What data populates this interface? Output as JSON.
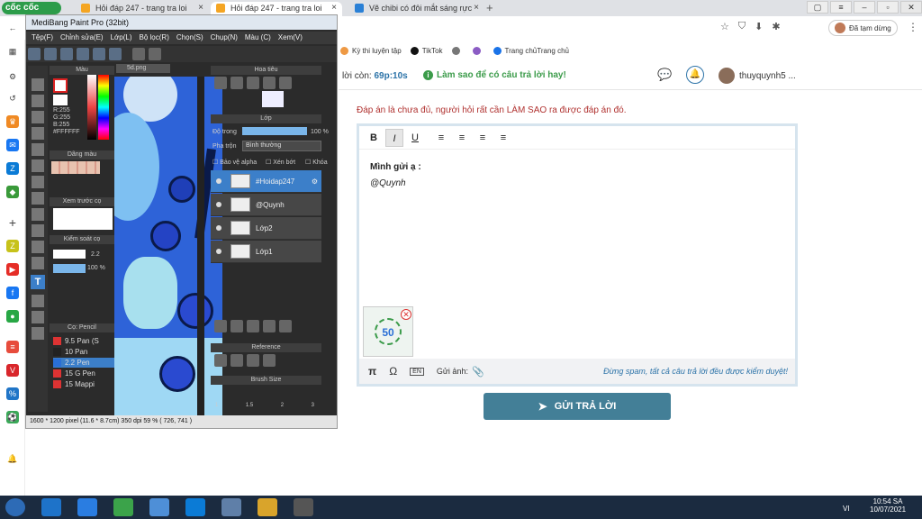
{
  "browser": {
    "logo": "cốc cốc",
    "tabs": [
      {
        "title": "Hỏi đáp 247 - trang tra loi",
        "active": false
      },
      {
        "title": "Hỏi đáp 247 - trang tra loi",
        "active": true
      },
      {
        "title": "Vẽ chibi có đôi mắt sáng rực",
        "active": false
      }
    ],
    "new_tab": "+",
    "bookmarks": [
      "Kỳ thi luyện tập",
      "TikTok",
      "",
      "",
      "Trang chủ",
      "Trang chủ"
    ],
    "paused_label": "Đã tạm dừng"
  },
  "site": {
    "time_left_label": "lời còn:",
    "time_left_value": "69p:10s",
    "tip": "Làm sao để có câu trả lời hay!",
    "username": "thuyquynh5 ...",
    "instruction": "Đáp án là chưa đủ, người hỏi rất cần LÀM SAO ra được đáp án đó.",
    "editor": {
      "tools": [
        "B",
        "I",
        "U",
        "≡",
        "≡",
        "≡",
        "≡"
      ],
      "line1": "Mình gửi ạ :",
      "line2": "@Quynh",
      "thumb_text": "50"
    },
    "footer": {
      "pi": "π",
      "omega": "Ω",
      "attach_label": "Gửi ảnh:",
      "notice": "Đừng spam, tất cả câu trả lời đều được kiểm duyệt!"
    },
    "submit_label": "GỬI TRẢ LỜI"
  },
  "medibang": {
    "title": "MediBang Paint Pro (32bit)",
    "menu": [
      "Tệp(F)",
      "Chỉnh sửa(E)",
      "Lớp(L)",
      "Bộ lọc(R)",
      "Chọn(S)",
      "Chụp(N)",
      "Màu (C)",
      "Xem(V)"
    ],
    "panels": {
      "color": "Màu",
      "color_values": [
        "R:255",
        "G:255",
        "B:255",
        "#FFFFFF"
      ],
      "color_bar": "Dãng màu",
      "preview": "Xem trước cọ",
      "brush_control": "Kiểm soát cọ",
      "brush_size": "2.2",
      "brush_opacity": "100 %",
      "brush_list": "Cọ: Pencil",
      "navigator": "Hoa tiêu",
      "layer": "Lớp",
      "opacity_label": "Độ trong",
      "opacity_value": "100 %",
      "blend_label": "Pha trộn",
      "blend_value": "Bình thường",
      "protect_alpha": "Bảo vệ alpha",
      "clipping": "Xén bớt",
      "lock": "Khóa",
      "reference": "Reference",
      "brush_size_panel": "Brush Size",
      "canvas_tab": "5d.png"
    },
    "layers": [
      {
        "name": "#Hoidap247",
        "selected": true
      },
      {
        "name": "@Quynh",
        "selected": false
      },
      {
        "name": "Lớp2",
        "selected": false
      },
      {
        "name": "Lớp1",
        "selected": false
      }
    ],
    "pens": [
      {
        "size": "9.5",
        "name": "Pan (S",
        "color": "#d33"
      },
      {
        "size": "10",
        "name": "Pan",
        "color": "#222"
      },
      {
        "size": "2.2",
        "name": "Pen",
        "color": "#2a6fd6"
      },
      {
        "size": "15",
        "name": "G Pen",
        "color": "#d33"
      },
      {
        "size": "15",
        "name": "Mappi",
        "color": "#d33"
      }
    ],
    "brush_sizes": [
      "1",
      "1.5",
      "2",
      "3"
    ],
    "status": "1600 * 1200 pixel   (11.6 * 8.7cm)   350 dpi   59 %   ( 726, 741 )"
  },
  "taskbar": {
    "time": "10:54 SA",
    "date": "10/07/2021",
    "lang": "VI"
  },
  "colors": {
    "accent": "#437f97",
    "instruction": "#b0312f",
    "selected_layer": "#3c7fc9"
  }
}
